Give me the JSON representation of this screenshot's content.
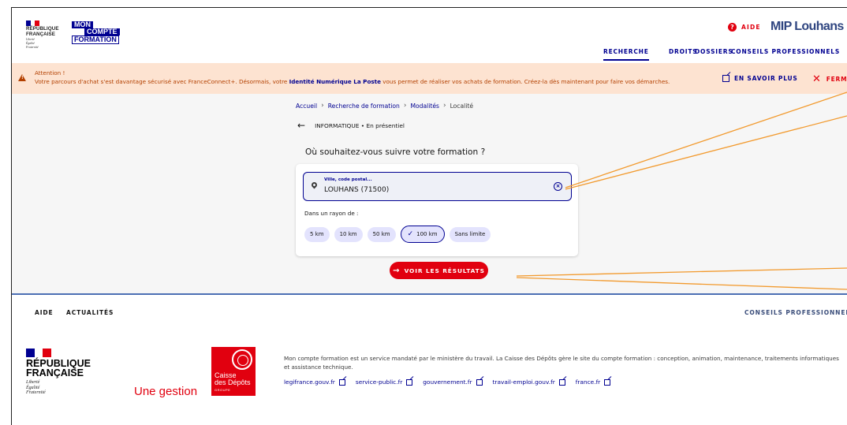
{
  "header": {
    "rf_logo_lines": [
      "RÉPUBLIQUE",
      "FRANÇAISE"
    ],
    "rf_motto": [
      "Liberté",
      "Égalité",
      "Fraternité"
    ],
    "mcf_logo": [
      "MON",
      "COMPTE",
      "FORMATION"
    ],
    "aide": "AIDE",
    "org_label": "MIP Louhans",
    "nav": [
      "RECHERCHE",
      "DROITS",
      "DOSSIERS",
      "CONSEILS PROFESSIONNELS"
    ]
  },
  "alert": {
    "title": "Attention !",
    "text_before": "Votre parcours d'achat s'est davantage sécurisé avec FranceConnect+. Désormais, votre ",
    "text_link": "Identité Numérique La Poste",
    "text_after": " vous permet de réaliser vos achats de formation. Créez-la dès maintenant pour faire vos démarches.",
    "more": "EN SAVOIR PLUS",
    "close": "FERME"
  },
  "breadcrumb": [
    "Accueil",
    "Recherche de formation",
    "Modalités",
    "Localité"
  ],
  "back_label": "INFORMATIQUE • En présentiel",
  "question": "Où souhaitez-vous suivre votre formation ?",
  "location_field": {
    "label": "Ville, code postal...",
    "value": "LOUHANS (71500)"
  },
  "radius_label": "Dans un rayon de :",
  "radius_options": [
    "5 km",
    "10 km",
    "50 km",
    "100 km",
    "Sans limite"
  ],
  "radius_selected": "100 km",
  "cta_label": "VOIR LES RÉSULTATS",
  "footer": {
    "nav_left": [
      "AIDE",
      "ACTUALITÉS"
    ],
    "nav_right": "CONSEILS PROFESSIONNELS",
    "rf_logo_lines": [
      "RÉPUBLIQUE",
      "FRANÇAISE"
    ],
    "rf_motto": [
      "Liberté",
      "Égalité",
      "Fraternité"
    ],
    "gestion": "Une gestion",
    "cdc_logo": [
      "Caisse",
      "des Dépôts",
      "GROUPE"
    ],
    "description": "Mon compte formation est un service mandaté par le ministère du travail. La Caisse des Dépôts gère le site du compte formation : conception, animation, maintenance, traitements informatiques et assistance technique.",
    "links": [
      "legifrance.gouv.fr",
      "service-public.fr",
      "gouvernement.fr",
      "travail-emploi.gouv.fr",
      "france.fr"
    ]
  },
  "colors": {
    "primary_blue": "#000091",
    "marianne_red": "#e1000f",
    "alert_bg": "#fde3d1",
    "alert_text": "#b34000",
    "annotation_line": "#f29a2e"
  },
  "icons": [
    "help-icon",
    "warning-icon",
    "external-link-icon",
    "close-icon",
    "back-arrow-icon",
    "location-pin-icon",
    "clear-circle-icon",
    "check-icon",
    "arrow-right-icon"
  ]
}
